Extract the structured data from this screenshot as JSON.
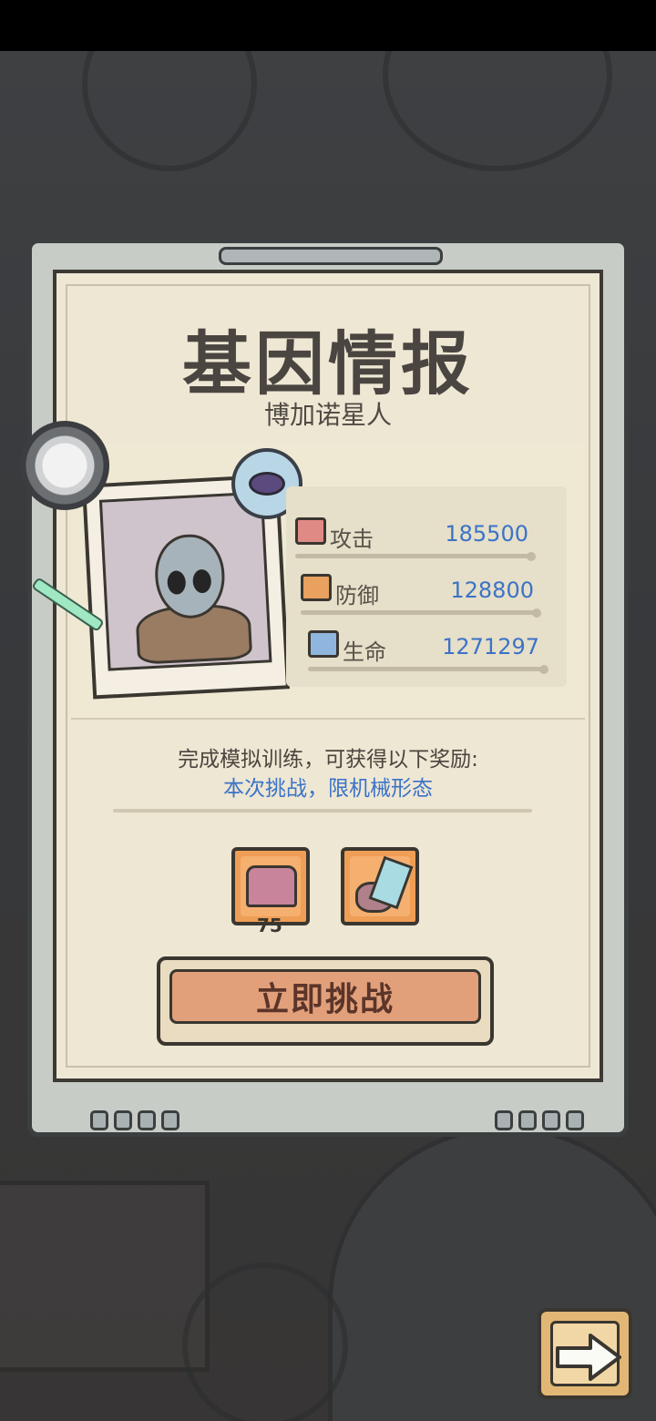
{
  "panel": {
    "title": "基因情报",
    "subtitle": "博加诺星人"
  },
  "stats": [
    {
      "label": "攻击",
      "value": "185500",
      "icon": "attack-icon"
    },
    {
      "label": "防御",
      "value": "128800",
      "icon": "defense-icon"
    },
    {
      "label": "生命",
      "value": "1271297",
      "icon": "health-icon"
    }
  ],
  "reward": {
    "text": "完成模拟训练，可获得以下奖励:",
    "note": "本次挑战，限机械形态",
    "items": [
      {
        "icon": "treasure-chest-icon",
        "count": "75"
      },
      {
        "icon": "crystal-claw-icon"
      }
    ]
  },
  "buttons": {
    "challenge": "立即挑战",
    "next": "arrow-right-icon"
  },
  "colors": {
    "value_blue": "#3b73c8",
    "button_orange": "#e2a07a",
    "reward_orange": "#ef9e56",
    "paper": "#eee7d4"
  }
}
